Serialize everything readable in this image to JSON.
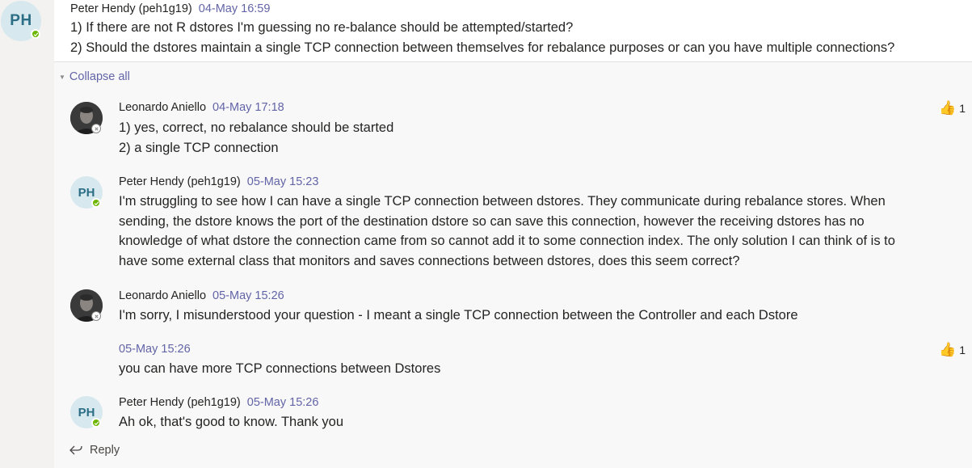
{
  "root_post": {
    "avatar_initials": "PH",
    "author": "Peter Hendy (peh1g19)",
    "timestamp": "04-May 16:59",
    "lines": [
      "1) If there are not R dstores I'm guessing no re-balance should be attempted/started?",
      "2) Should the dstores maintain a single TCP connection between themselves for rebalance purposes or can you have multiple connections?"
    ]
  },
  "collapse_label": "Collapse all",
  "replies": [
    {
      "author": "Leonardo Aniello",
      "timestamp": "04-May 17:18",
      "lines": [
        "1) yes, correct, no rebalance should be started",
        "2) a single TCP connection"
      ],
      "reaction_count": "1"
    },
    {
      "avatar_initials": "PH",
      "author": "Peter Hendy (peh1g19)",
      "timestamp": "05-May 15:23",
      "lines": [
        "I'm struggling to see how I can have a single TCP connection between dstores. They communicate during rebalance stores. When",
        "sending, the dstore knows the port of the destination dstore so can save this connection, however the receiving dstores has no",
        "knowledge of what dstore the connection came from so cannot add it to some connection index. The only solution I can think of is to",
        "have some external class that monitors and saves connections between dstores, does this seem correct?"
      ]
    },
    {
      "author": "Leonardo Aniello",
      "timestamp": "05-May 15:26",
      "lines": [
        "I'm sorry, I misunderstood your question - I meant a single TCP connection between the Controller and each Dstore"
      ]
    },
    {
      "timestamp": "05-May 15:26",
      "lines": [
        "you can have more TCP connections between Dstores"
      ],
      "reaction_count": "1"
    },
    {
      "avatar_initials": "PH",
      "author": "Peter Hendy (peh1g19)",
      "timestamp": "05-May 15:26",
      "lines": [
        "Ah ok, that's good to know. Thank you"
      ]
    }
  ],
  "reply_label": "Reply",
  "icons": [
    "check-icon",
    "thumbs-up-icon",
    "reply-arrow-icon",
    "caret-down-icon"
  ],
  "colors": {
    "accent": "#6264a7",
    "presence_available": "#6bb700",
    "avatar_bg": "#d7e8ee",
    "avatar_fg": "#2b6e85"
  }
}
